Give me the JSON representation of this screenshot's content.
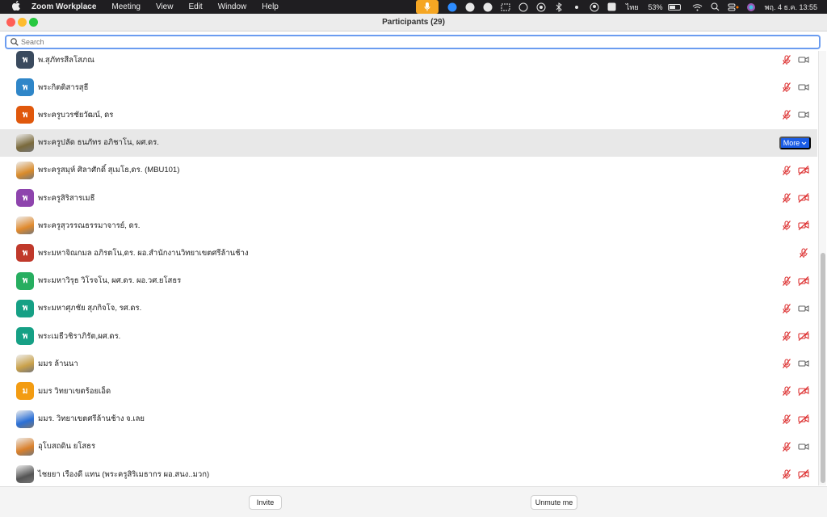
{
  "menubar": {
    "apple_icon": "apple-icon",
    "items": [
      "Zoom Workplace",
      "Meeting",
      "View",
      "Edit",
      "Window",
      "Help"
    ],
    "input_lang": "ไทย",
    "battery": "53%",
    "datetime": "พฤ. 4 ธ.ค.  13:55"
  },
  "window": {
    "title": "Participants (29)"
  },
  "search": {
    "placeholder": "Search"
  },
  "participants": [
    {
      "name": "พ.สุภัทรสีลโสภณ",
      "initial": "พ",
      "color": "#3a4a5e",
      "photo": false,
      "mic": "muted",
      "cam": "on"
    },
    {
      "name": "พระกิตติสารสุธี",
      "initial": "พ",
      "color": "#2f86c8",
      "photo": false,
      "mic": "muted",
      "cam": "on"
    },
    {
      "name": "พระครูบวรชัยวัฒน์, ดร",
      "initial": "พ",
      "color": "#e0580c",
      "photo": false,
      "mic": "muted",
      "cam": "on"
    },
    {
      "name": "พระครูปลัด ธนภัทร อภิชาโน, ผศ.ดร.",
      "initial": "",
      "color": "#7a6a3c",
      "photo": true,
      "mic": "none",
      "cam": "none",
      "more": true
    },
    {
      "name": "พระครูสมุห์ ศิลาศักดิ์ สุเมโธ,ดร. (MBU101)",
      "initial": "",
      "color": "#d98b2b",
      "photo": true,
      "mic": "muted",
      "cam": "off"
    },
    {
      "name": "พระครูสิริสารเมธี",
      "initial": "พ",
      "color": "#8e44ad",
      "photo": false,
      "mic": "muted",
      "cam": "off"
    },
    {
      "name": "พระครูสุวรรณธรรมาจารย์, ดร.",
      "initial": "",
      "color": "#e08a2e",
      "photo": true,
      "mic": "muted",
      "cam": "off"
    },
    {
      "name": "พระมหาจิณกมล อภิรตโน,ดร. ผอ.สำนักงานวิทยาเขตศรีล้านช้าง",
      "initial": "พ",
      "color": "#c0392b",
      "photo": false,
      "mic": "muted",
      "cam": "none"
    },
    {
      "name": "พระมหาวิรุธ วิโรจโน, ผศ.ดร. ผอ.วศ.ยโสธร",
      "initial": "พ",
      "color": "#27ae60",
      "photo": false,
      "mic": "muted",
      "cam": "off"
    },
    {
      "name": "พระมหาศุภชัย สุภกิจโจ, รศ.ดร.",
      "initial": "พ",
      "color": "#16a085",
      "photo": false,
      "mic": "muted",
      "cam": "on"
    },
    {
      "name": "พระเมธีวชิราภิรัต,ผศ.ดร.",
      "initial": "พ",
      "color": "#16a085",
      "photo": false,
      "mic": "muted",
      "cam": "off"
    },
    {
      "name": "มมร ล้านนา",
      "initial": "",
      "color": "#c9a14a",
      "photo": true,
      "mic": "muted",
      "cam": "on"
    },
    {
      "name": "มมร วิทยาเขตร้อยเอ็ด",
      "initial": "ม",
      "color": "#f39c12",
      "photo": false,
      "mic": "muted",
      "cam": "off"
    },
    {
      "name": "มมร. วิทยาเขตศรีล้านช้าง จ.เลย",
      "initial": "",
      "color": "#2a6fd6",
      "photo": true,
      "mic": "muted",
      "cam": "off"
    },
    {
      "name": "อุโบสถดิน ยโสธร",
      "initial": "",
      "color": "#d9802b",
      "photo": true,
      "mic": "muted",
      "cam": "on"
    },
    {
      "name": "ไชยยา  เรืองดี แทน (พระครูสิริเมธากร ผอ.สนง..มวก)",
      "initial": "",
      "color": "#555555",
      "photo": true,
      "mic": "muted",
      "cam": "off"
    }
  ],
  "row_actions": {
    "more_label": "More"
  },
  "footer": {
    "invite_label": "Invite",
    "unmute_label": "Unmute me"
  }
}
